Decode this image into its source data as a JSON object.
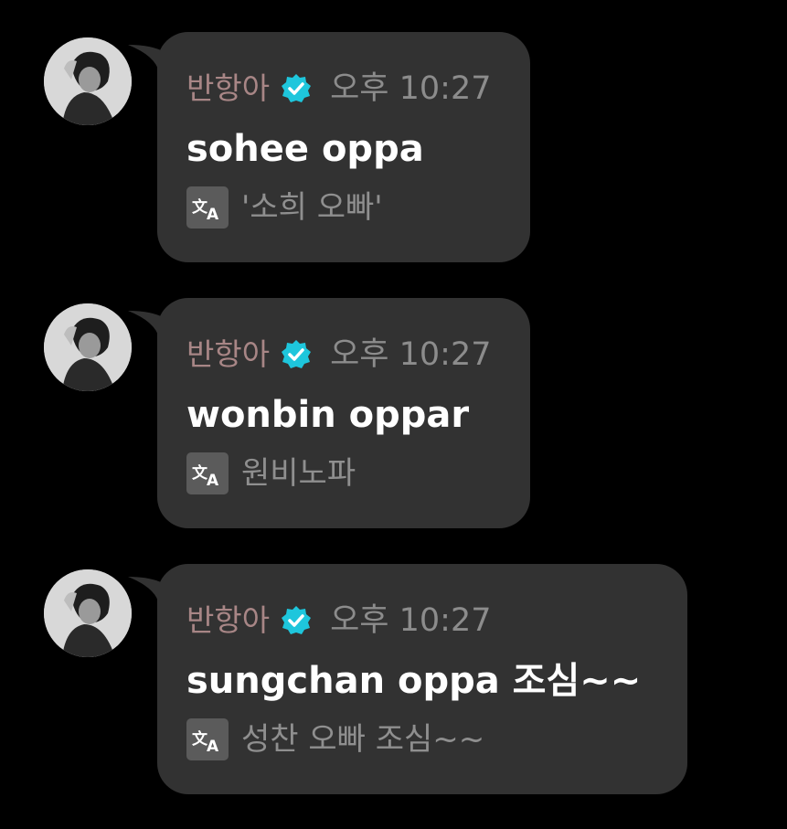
{
  "messages": [
    {
      "author": "반항아",
      "time": "오후 10:27",
      "text": "sohee oppa",
      "translation": "'소희 오빠'"
    },
    {
      "author": "반항아",
      "time": "오후 10:27",
      "text": "wonbin oppar",
      "translation": "원비노파"
    },
    {
      "author": "반항아",
      "time": "오후 10:27",
      "text": "sungchan oppa 조심~~",
      "translation": "성찬 오빠 조심~~"
    }
  ],
  "icons": {
    "verified": "verified-badge-icon",
    "translate": "translate-icon"
  },
  "colors": {
    "background": "#000000",
    "bubble": "#323232",
    "author": "#a88686",
    "verified": "#1ec6dc",
    "time": "#8c8c8c",
    "text": "#ffffff",
    "translation": "#8f8f8f"
  }
}
